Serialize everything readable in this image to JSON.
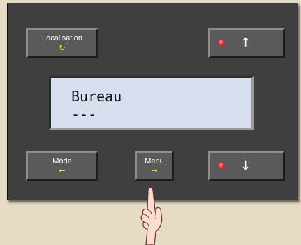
{
  "device": {
    "buttons": {
      "localisation": {
        "label": "Localisation",
        "symbol": "↻"
      },
      "up": {
        "arrow": "↑",
        "led_color": "#ff2a2a"
      },
      "mode": {
        "label": "Mode",
        "symbol": "←"
      },
      "menu": {
        "label": "Menu",
        "symbol": "→"
      },
      "down": {
        "arrow": "↓",
        "led_color": "#ff2a2a"
      }
    },
    "display": {
      "line1": "Bureau",
      "line2": "---"
    }
  },
  "colors": {
    "background": "#e6dcc3",
    "panel": "#3f3f3f",
    "button_face": "#5a5a5a",
    "symbol_yellow": "#ffea00",
    "lcd_background": "#d7dfee",
    "led_red": "#ff2a2a"
  },
  "pointer": {
    "icon": "pointing-hand-icon"
  }
}
